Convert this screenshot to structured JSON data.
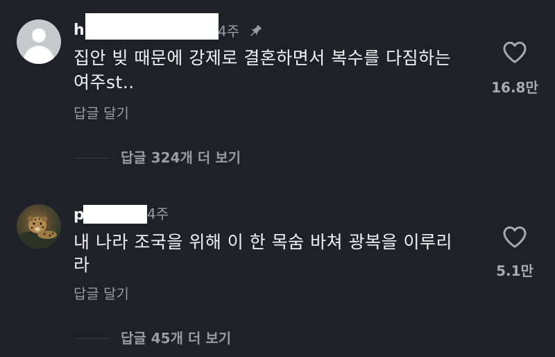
{
  "comments": [
    {
      "username": "h",
      "time": "4주",
      "pinned": true,
      "text_line1": "집안 빚 때문에 강제로 결혼하면서 복수를 다짐하는",
      "text_line2": "여주st..",
      "reply_label": "답글 달기",
      "likes": "16.8만",
      "view_replies": "답글 324개 더 보기",
      "avatar": "default-avatar"
    },
    {
      "username": "p",
      "time": "4주",
      "pinned": false,
      "text_line1": "내 나라 조국을 위해 이 한 목숨 바쳐 광복을 이루리",
      "text_line2": "라",
      "reply_label": "답글 달기",
      "likes": "5.1만",
      "view_replies": "답글 45개 더 보기",
      "avatar": "leopard-photo"
    }
  ],
  "icons": {
    "like": "heart-outline-icon",
    "pin": "pin-icon"
  },
  "colors": {
    "background": "#1f2028",
    "primary_text": "#f2f2f4",
    "secondary_text": "#9a9ba3"
  }
}
